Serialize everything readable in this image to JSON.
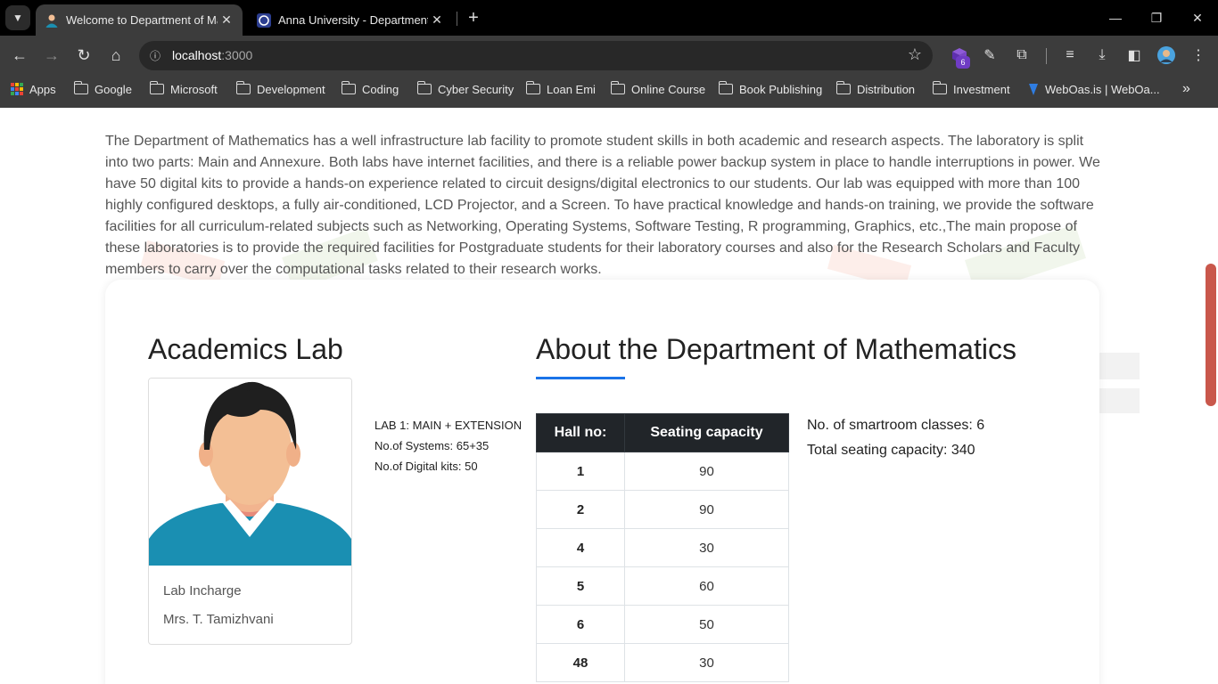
{
  "browser": {
    "tabs": [
      {
        "title": "Welcome to Department of Mathematics",
        "active": true
      },
      {
        "title": "Anna University - Department of Mathematics",
        "active": false
      }
    ],
    "url_host": "localhost",
    "url_port": ":3000",
    "extension_badge": "6",
    "bookmarks": [
      "Apps",
      "Google",
      "Microsoft",
      "Development",
      "Coding",
      "Cyber Security",
      "Loan Emi",
      "Online Course",
      "Book Publishing",
      "Distribution",
      "Investment",
      "WebOas.is | WebOa..."
    ],
    "icons": {
      "tab_menu": "chevron-down-icon",
      "close": "close-icon",
      "new_tab": "plus-icon",
      "back": "back-arrow-icon",
      "forward": "forward-arrow-icon",
      "reload": "reload-icon",
      "home": "home-icon",
      "site_info": "info-icon",
      "bookmark_star": "star-icon",
      "more_bookmarks": "double-chevron-icon"
    }
  },
  "intro_text": "The Department of Mathematics has a well infrastructure lab facility to promote student skills in both academic and research aspects. The laboratory is split into two parts: Main and Annexure. Both labs have internet facilities, and there is a reliable power backup system in place to handle interruptions in power. We have 50 digital kits to provide a hands-on experience related to circuit designs/digital electronics to our students. Our lab was equipped with more than 100 highly configured desktops, a fully air-conditioned, LCD Projector, and a Screen. To have practical knowledge and hands-on training, we provide the software facilities for all curriculum-related subjects such as Networking, Operating Systems, Software Testing, R programming, Graphics, etc.,The main propose of these laboratories is to provide the required facilities for Postgraduate students for their laboratory courses and also for the Research Scholars and Faculty members to carry over the computational tasks related to their research works.",
  "lab": {
    "title": "Academics Lab",
    "incharge_role": "Lab Incharge",
    "incharge_name": "Mrs. T. Tamizhvani",
    "info": [
      "LAB 1: MAIN + EXTENSION",
      "No.of Systems: 65+35",
      "No.of Digital kits: 50"
    ]
  },
  "about": {
    "title": "About the Department of Mathematics",
    "table_headers": [
      "Hall no:",
      "Seating capacity"
    ],
    "rows": [
      {
        "hall": "1",
        "capacity": "90"
      },
      {
        "hall": "2",
        "capacity": "90"
      },
      {
        "hall": "4",
        "capacity": "30"
      },
      {
        "hall": "5",
        "capacity": "60"
      },
      {
        "hall": "6",
        "capacity": "50"
      },
      {
        "hall": "48",
        "capacity": "30"
      }
    ],
    "smartroom": "No. of smartroom classes: 6",
    "total_seating": "Total seating capacity: 340"
  },
  "colors": {
    "accent_underline": "#1a73e8",
    "table_header_bg": "#212529",
    "scrollbar_thumb": "#c0392b"
  }
}
